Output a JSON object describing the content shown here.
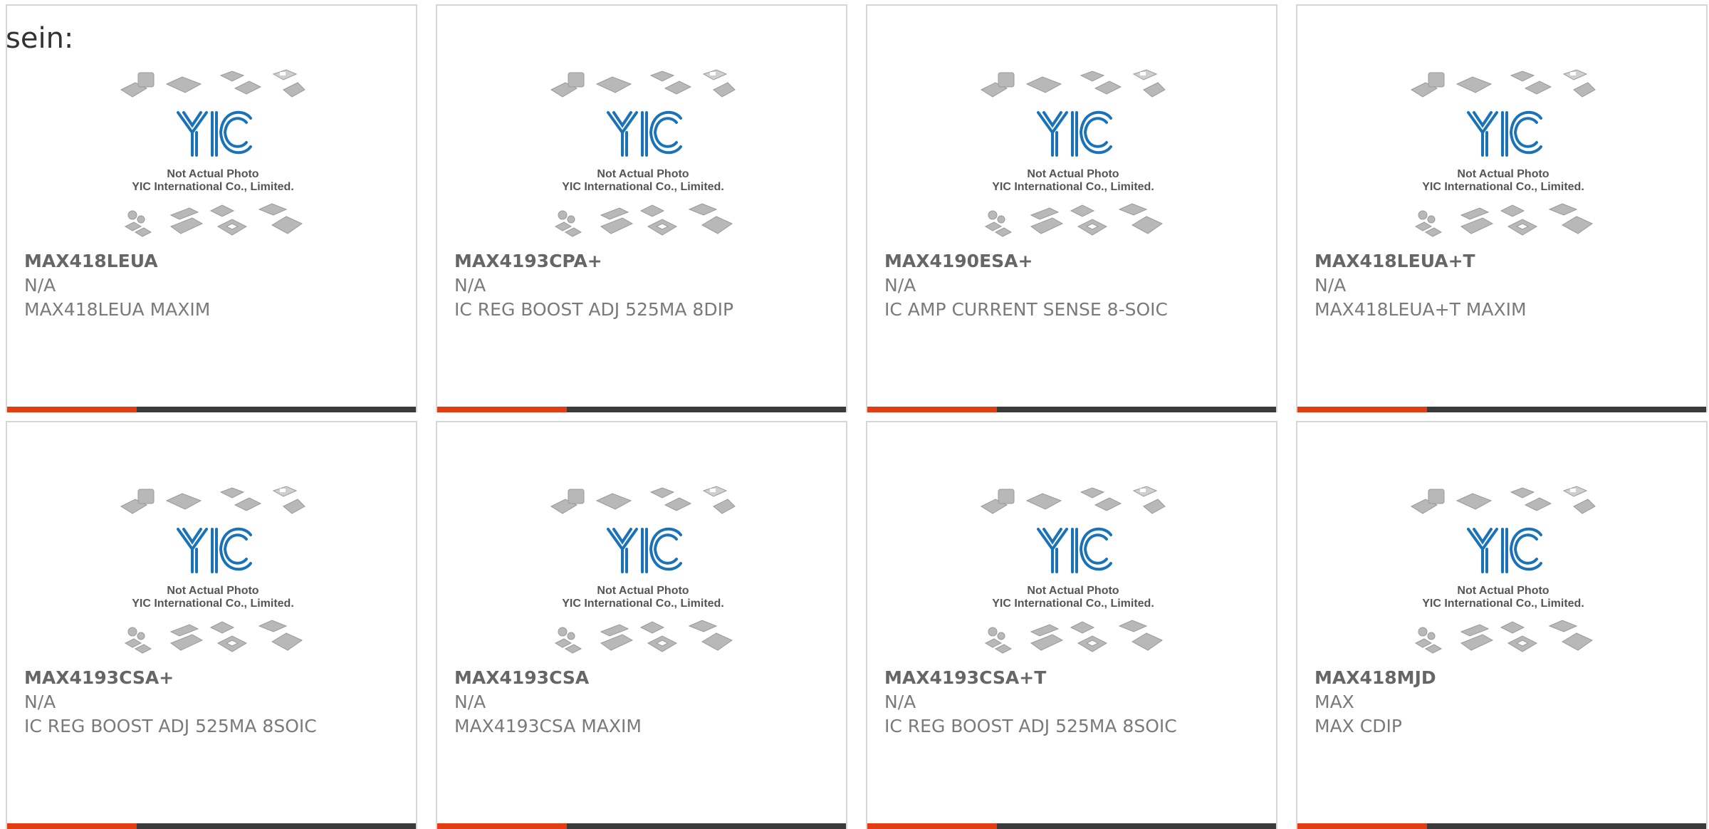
{
  "lead_text": "sein:",
  "photo_placeholder": {
    "line1": "Not Actual Photo",
    "line2": "YIC International Co., Limited.",
    "logo": "YIC",
    "icon": "chip-packages-icon"
  },
  "colors": {
    "accent_bar": "#e23d12",
    "dark_bar": "#3a3a3a",
    "logo_blue": "#1a73b8"
  },
  "products": [
    {
      "part": "MAX418LEUA",
      "maker": "N/A",
      "desc": "MAX418LEUA MAXIM"
    },
    {
      "part": "MAX4193CPA+",
      "maker": "N/A",
      "desc": "IC REG BOOST ADJ 525MA 8DIP"
    },
    {
      "part": "MAX4190ESA+",
      "maker": "N/A",
      "desc": "IC AMP CURRENT SENSE 8-SOIC"
    },
    {
      "part": "MAX418LEUA+T",
      "maker": "N/A",
      "desc": "MAX418LEUA+T MAXIM"
    },
    {
      "part": "MAX4193CSA+",
      "maker": "N/A",
      "desc": "IC REG BOOST ADJ 525MA 8SOIC"
    },
    {
      "part": "MAX4193CSA",
      "maker": "N/A",
      "desc": "MAX4193CSA MAXIM"
    },
    {
      "part": "MAX4193CSA+T",
      "maker": "N/A",
      "desc": "IC REG BOOST ADJ 525MA 8SOIC"
    },
    {
      "part": "MAX418MJD",
      "maker": "MAX",
      "desc": "MAX CDIP"
    }
  ]
}
